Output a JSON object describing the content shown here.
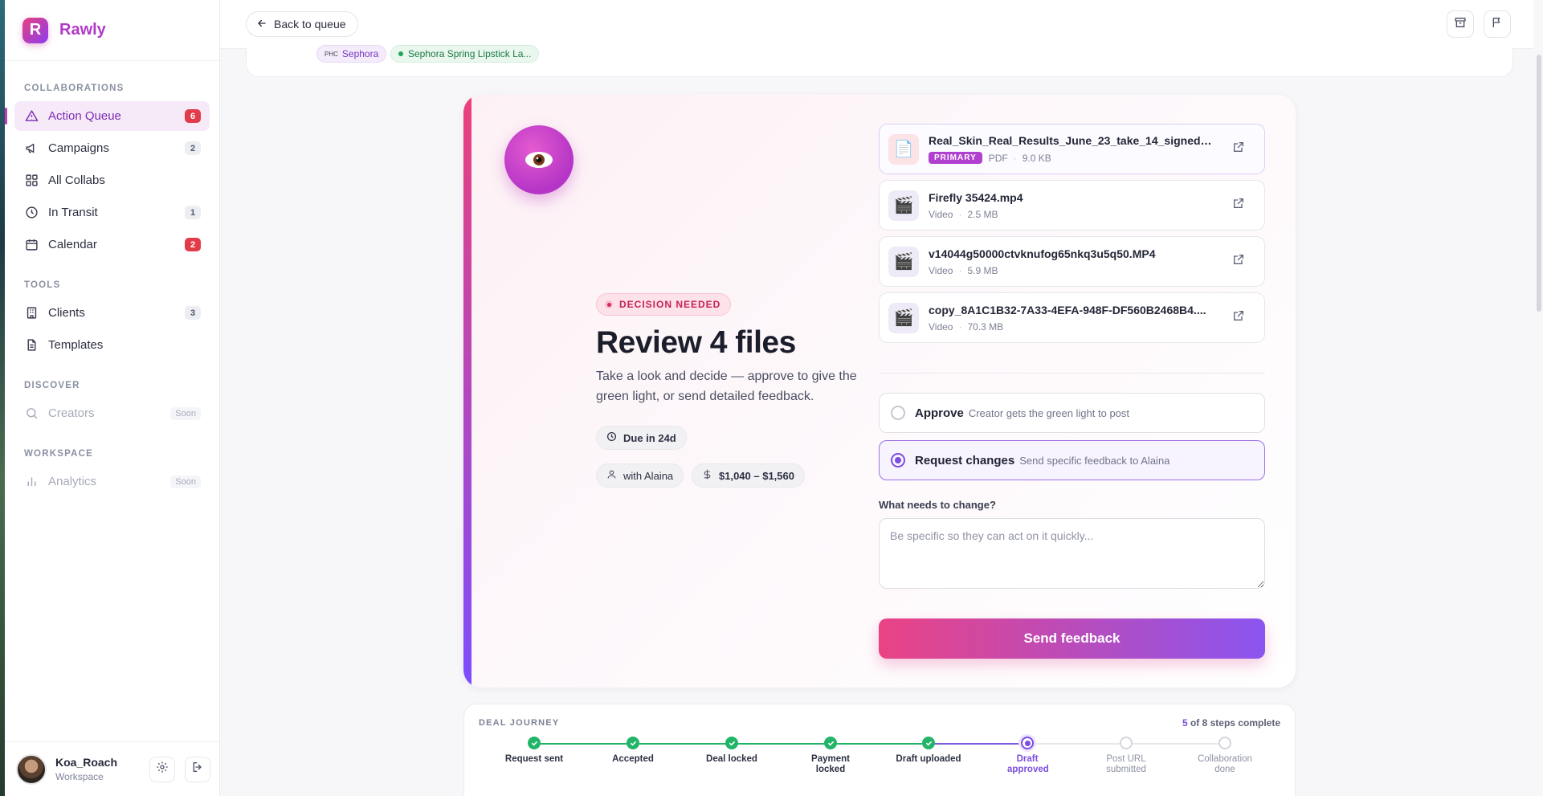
{
  "brand": {
    "name": "Rawly",
    "logo_letter": "R"
  },
  "sidebar": {
    "sections": [
      {
        "label": "COLLABORATIONS"
      },
      {
        "label": "TOOLS"
      },
      {
        "label": "DISCOVER"
      },
      {
        "label": "WORKSPACE"
      }
    ],
    "items": [
      {
        "label": "Action Queue",
        "badge": "6",
        "icon": "alert-triangle-icon",
        "active": true
      },
      {
        "label": "Campaigns",
        "badge": "2",
        "icon": "megaphone-icon"
      },
      {
        "label": "All Collabs",
        "badge": "",
        "icon": "grid-icon"
      },
      {
        "label": "In Transit",
        "badge": "1",
        "icon": "clock-icon"
      },
      {
        "label": "Calendar",
        "badge": "2",
        "icon": "calendar-icon"
      },
      {
        "label": "Clients",
        "badge": "3",
        "icon": "building-icon"
      },
      {
        "label": "Templates",
        "badge": "",
        "icon": "file-text-icon"
      },
      {
        "label": "Creators",
        "tag": "Soon",
        "icon": "search-icon",
        "disabled": true
      },
      {
        "label": "Analytics",
        "tag": "Soon",
        "icon": "bar-chart-icon",
        "disabled": true
      }
    ]
  },
  "user": {
    "name": "Koa_Roach",
    "sub": "Workspace"
  },
  "topbar": {
    "back_label": "Back to queue"
  },
  "header": {
    "brand_chip_prefix": "PHC",
    "brand_chip": "Sephora",
    "campaign_chip": "Sephora Spring Lipstick La..."
  },
  "review": {
    "status": "DECISION NEEDED",
    "title": "Review 4 files",
    "description": "Take a look and decide — approve to give the green light, or send detailed feedback.",
    "due": "Due in 24d",
    "with": "with Alaina",
    "price": "$1,040 – $1,560"
  },
  "files": [
    {
      "name": "Real_Skin_Real_Results_June_23_take_14_signed_c...",
      "primary_tag": "PRIMARY",
      "type": "PDF",
      "size": "9.0 KB",
      "thumb": "📄"
    },
    {
      "name": "Firefly 35424.mp4",
      "type": "Video",
      "size": "2.5 MB",
      "thumb": "🎬"
    },
    {
      "name": "v14044g50000ctvknufog65nkq3u5q50.MP4",
      "type": "Video",
      "size": "5.9 MB",
      "thumb": "🎬"
    },
    {
      "name": "copy_8A1C1B32-7A33-4EFA-948F-DF560B2468B4....",
      "type": "Video",
      "size": "70.3 MB",
      "thumb": "🎬"
    }
  ],
  "options": {
    "approve_title": "Approve",
    "approve_desc": "Creator gets the green light to post",
    "changes_title": "Request changes",
    "changes_desc": "Send specific feedback to Alaina",
    "selected": "changes"
  },
  "feedback": {
    "label": "What needs to change?",
    "placeholder": "Be specific so they can act on it quickly...",
    "value": "",
    "send_label": "Send feedback"
  },
  "journey": {
    "label": "DEAL JOURNEY",
    "completed": "5",
    "count_suffix": "of 8 steps complete",
    "steps": [
      {
        "label": "Request sent",
        "state": "done"
      },
      {
        "label": "Accepted",
        "state": "done"
      },
      {
        "label": "Deal locked",
        "state": "done"
      },
      {
        "label": "Payment locked",
        "state": "done"
      },
      {
        "label": "Draft uploaded",
        "state": "done"
      },
      {
        "label": "Draft approved",
        "state": "current"
      },
      {
        "label": "Post URL submitted",
        "state": "todo"
      },
      {
        "label": "Collaboration done",
        "state": "todo"
      }
    ]
  },
  "colors": {
    "accent": "#7c4ddf",
    "brand_pink": "#e8417f",
    "success": "#22b567",
    "danger": "#e23c4a"
  }
}
